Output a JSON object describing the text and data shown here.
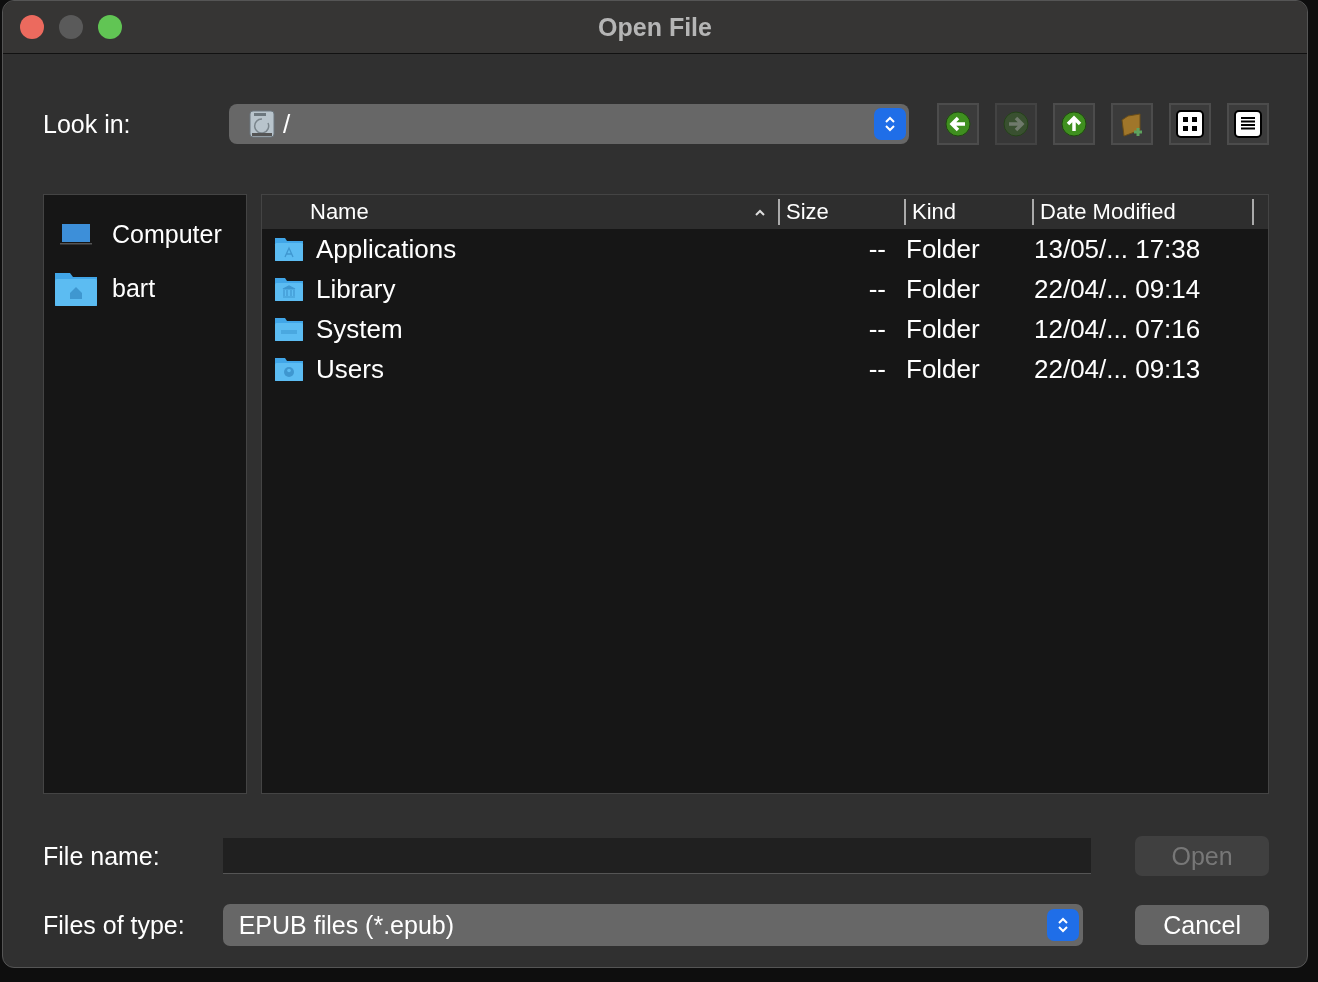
{
  "window": {
    "title": "Open File"
  },
  "look_in": {
    "label": "Look in:",
    "path": "/"
  },
  "toolbar": [
    {
      "kind": "back",
      "disabled": false
    },
    {
      "kind": "forward",
      "disabled": true
    },
    {
      "kind": "up",
      "disabled": false
    },
    {
      "kind": "new-folder",
      "disabled": false
    },
    {
      "kind": "icon-view",
      "disabled": false
    },
    {
      "kind": "list-view",
      "disabled": false
    }
  ],
  "sidebar": {
    "items": [
      {
        "label": "Computer",
        "kind": "computer"
      },
      {
        "label": "bart",
        "kind": "home"
      }
    ]
  },
  "table": {
    "columns": [
      {
        "label": "Name",
        "sorted": true
      },
      {
        "label": "Size",
        "sorted": false
      },
      {
        "label": "Kind",
        "sorted": false
      },
      {
        "label": "Date Modified",
        "sorted": false
      }
    ],
    "rows": [
      {
        "name": "Applications",
        "kind": "apps",
        "size": "--",
        "type": "Folder",
        "date": "13/05/... 17:38"
      },
      {
        "name": "Library",
        "kind": "library",
        "size": "--",
        "type": "Folder",
        "date": "22/04/... 09:14"
      },
      {
        "name": "System",
        "kind": "system",
        "size": "--",
        "type": "Folder",
        "date": "12/04/... 07:16"
      },
      {
        "name": "Users",
        "kind": "users",
        "size": "--",
        "type": "Folder",
        "date": "22/04/... 09:13"
      }
    ]
  },
  "file_name": {
    "label": "File name:"
  },
  "file_type": {
    "label": "Files of type:",
    "value": "EPUB files (*.epub)"
  },
  "buttons": [
    {
      "label": "Open",
      "disabled": true
    },
    {
      "label": "Cancel",
      "disabled": false
    }
  ]
}
